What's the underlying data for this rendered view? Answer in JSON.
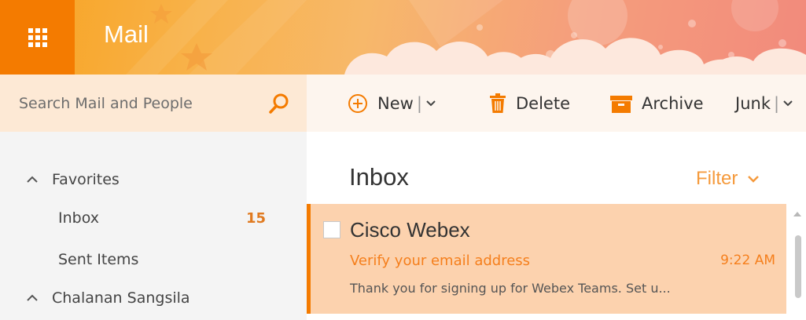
{
  "app": {
    "title": "Mail"
  },
  "search": {
    "placeholder": "Search Mail and People"
  },
  "nav": {
    "favorites_label": "Favorites",
    "items": [
      {
        "label": "Inbox",
        "count": "15"
      },
      {
        "label": "Sent Items"
      }
    ],
    "account_label": "Chalanan Sangsila"
  },
  "toolbar": {
    "new_label": "New",
    "delete_label": "Delete",
    "archive_label": "Archive",
    "junk_label": "Junk",
    "separator": "|"
  },
  "list": {
    "title": "Inbox",
    "filter_label": "Filter",
    "messages": [
      {
        "sender": "Cisco Webex",
        "subject": "Verify your email address",
        "time": "9:22 AM",
        "preview": "Thank you for signing up for Webex Teams. Set u..."
      }
    ]
  },
  "icons": {
    "waffle": "app-launcher-icon",
    "search": "search-icon",
    "new": "plus-circle-icon",
    "delete": "trash-icon",
    "archive": "archive-icon",
    "chevron": "chevron-down-icon",
    "collapse": "chevron-up-icon"
  },
  "colors": {
    "brand": "#f47b00",
    "accent_text": "#f57f1c",
    "selected_row": "#fcd2ae",
    "search_bg": "#fde9d5",
    "unread_count": "#e07a20"
  }
}
